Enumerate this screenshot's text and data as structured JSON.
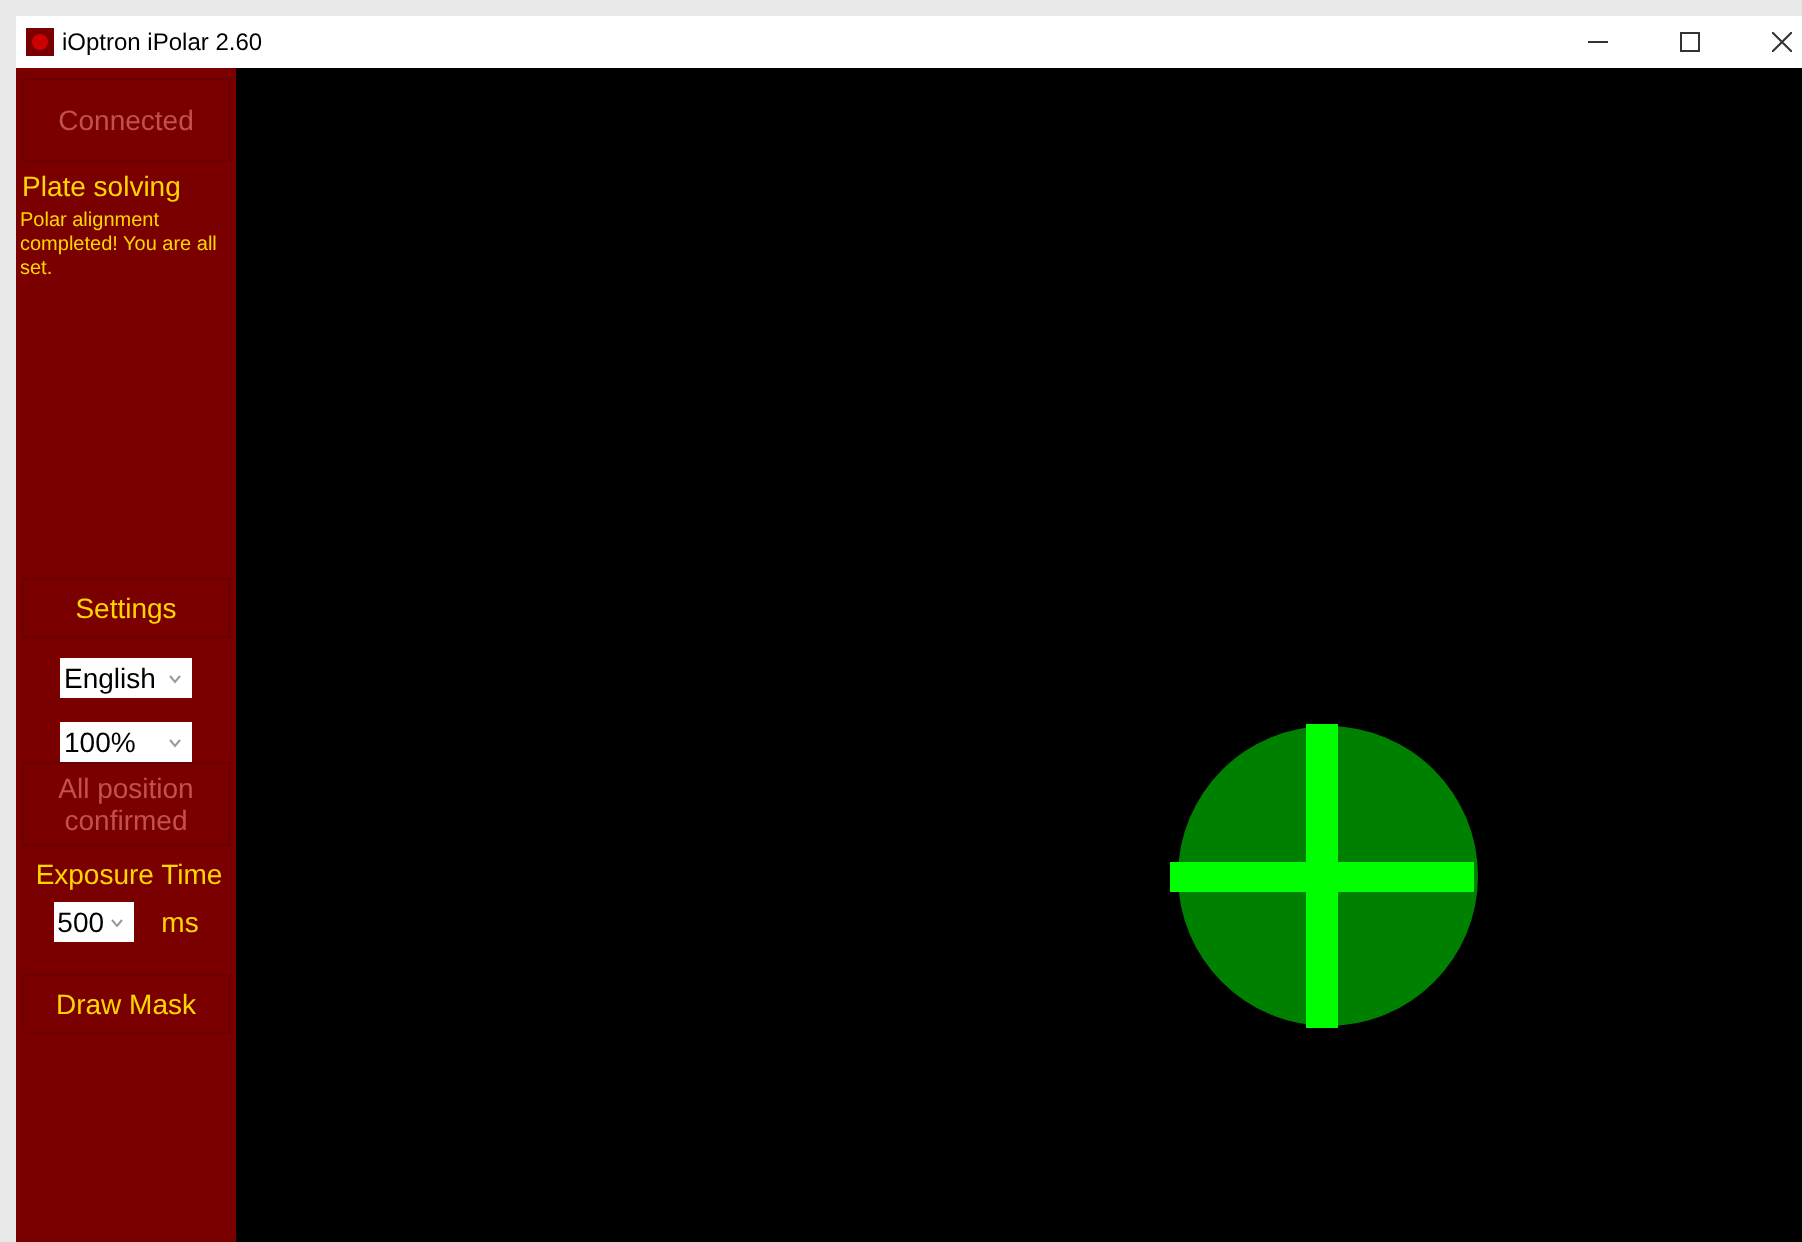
{
  "window": {
    "title": "iOptron iPolar 2.60"
  },
  "sidebar": {
    "items": [
      {
        "kind": "button",
        "label": "Connected",
        "disabled": true
      },
      {
        "kind": "heading",
        "label": "Plate solving"
      },
      {
        "kind": "message",
        "label": "Polar alignment completed! You are all set."
      },
      {
        "kind": "spacer"
      },
      {
        "kind": "button",
        "label": "Settings",
        "disabled": false
      },
      {
        "kind": "select",
        "value": "English"
      },
      {
        "kind": "select",
        "value": "100%"
      },
      {
        "kind": "button",
        "label": "All position confirmed",
        "disabled": true
      },
      {
        "kind": "heading",
        "label": "Exposure Time"
      },
      {
        "kind": "exposure",
        "value": "500",
        "unit": "ms"
      },
      {
        "kind": "button",
        "label": "Draw Mask",
        "disabled": false
      }
    ]
  }
}
